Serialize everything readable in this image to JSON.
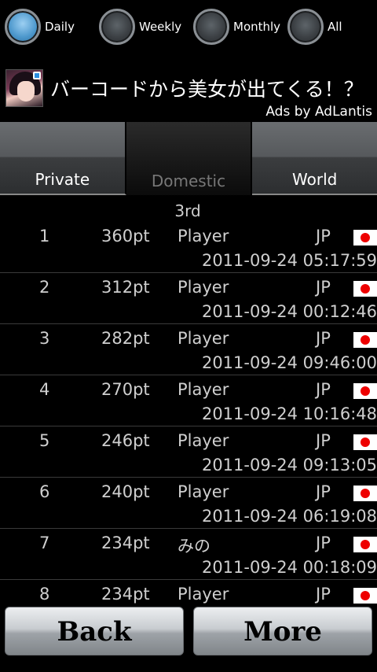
{
  "period": {
    "options": [
      {
        "label": "Daily",
        "selected": true
      },
      {
        "label": "Weekly",
        "selected": false
      },
      {
        "label": "Monthly",
        "selected": false
      },
      {
        "label": "All",
        "selected": false
      }
    ]
  },
  "ad": {
    "title": "バーコードから美女が出てくる！？",
    "by": "Ads by AdLantis"
  },
  "tabs": [
    {
      "label": "Private",
      "active": false
    },
    {
      "label": "Domestic",
      "active": true
    },
    {
      "label": "World",
      "active": false
    }
  ],
  "ranking": {
    "heading": "3rd",
    "rows": [
      {
        "rank": "1",
        "points": "360pt",
        "player": "Player",
        "country": "JP",
        "date": "2011-09-24 05:17:59"
      },
      {
        "rank": "2",
        "points": "312pt",
        "player": "Player",
        "country": "JP",
        "date": "2011-09-24 00:12:46"
      },
      {
        "rank": "3",
        "points": "282pt",
        "player": "Player",
        "country": "JP",
        "date": "2011-09-24 09:46:00"
      },
      {
        "rank": "4",
        "points": "270pt",
        "player": "Player",
        "country": "JP",
        "date": "2011-09-24 10:16:48"
      },
      {
        "rank": "5",
        "points": "246pt",
        "player": "Player",
        "country": "JP",
        "date": "2011-09-24 09:13:05"
      },
      {
        "rank": "6",
        "points": "240pt",
        "player": "Player",
        "country": "JP",
        "date": "2011-09-24 06:19:08"
      },
      {
        "rank": "7",
        "points": "234pt",
        "player": "みの",
        "country": "JP",
        "date": "2011-09-24 00:18:09"
      },
      {
        "rank": "8",
        "points": "234pt",
        "player": "Player",
        "country": "JP",
        "date": ""
      }
    ]
  },
  "buttons": {
    "back": "Back",
    "more": "More"
  }
}
